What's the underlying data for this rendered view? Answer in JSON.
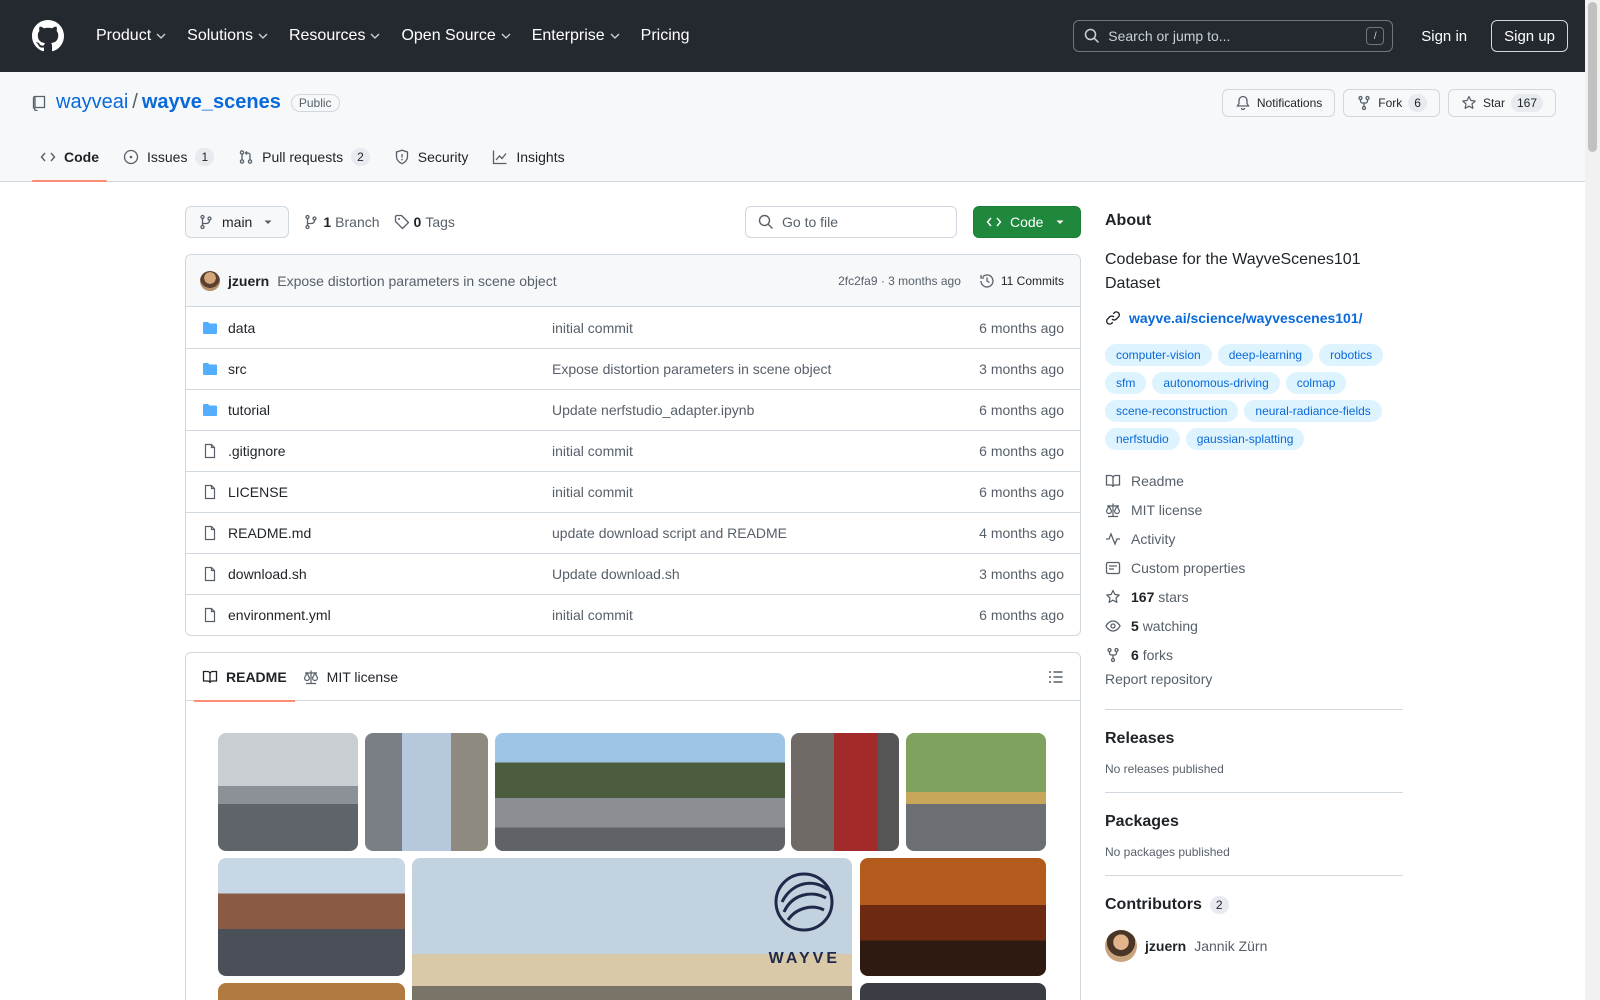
{
  "header": {
    "nav": [
      "Product",
      "Solutions",
      "Resources",
      "Open Source",
      "Enterprise",
      "Pricing"
    ],
    "search_placeholder": "Search or jump to...",
    "slash": "/",
    "signin": "Sign in",
    "signup": "Sign up"
  },
  "repo": {
    "owner": "wayveai",
    "sep": "/",
    "name": "wayve_scenes",
    "visibility": "Public",
    "notifications": "Notifications",
    "fork": "Fork",
    "fork_count": "6",
    "star": "Star",
    "star_count": "167"
  },
  "tabs": {
    "code": "Code",
    "issues": "Issues",
    "issues_count": "1",
    "pulls": "Pull requests",
    "pulls_count": "2",
    "security": "Security",
    "insights": "Insights"
  },
  "toolbar": {
    "branch": "main",
    "branches_count": "1",
    "branches_label": "Branch",
    "tags_count": "0",
    "tags_label": "Tags",
    "goto": "Go to file",
    "code": "Code"
  },
  "commit": {
    "author": "jzuern",
    "message": "Expose distortion parameters in scene object",
    "meta": "2fc2fa9 · 3 months ago",
    "commits": "11 Commits"
  },
  "files": [
    {
      "name": "data",
      "type": "dir",
      "message": "initial commit",
      "age": "6 months ago"
    },
    {
      "name": "src",
      "type": "dir",
      "message": "Expose distortion parameters in scene object",
      "age": "3 months ago"
    },
    {
      "name": "tutorial",
      "type": "dir",
      "message": "Update nerfstudio_adapter.ipynb",
      "age": "6 months ago"
    },
    {
      "name": ".gitignore",
      "type": "file",
      "message": "initial commit",
      "age": "6 months ago"
    },
    {
      "name": "LICENSE",
      "type": "file",
      "message": "initial commit",
      "age": "6 months ago"
    },
    {
      "name": "README.md",
      "type": "file",
      "message": "update download script and README",
      "age": "4 months ago"
    },
    {
      "name": "download.sh",
      "type": "file",
      "message": "Update download.sh",
      "age": "3 months ago"
    },
    {
      "name": "environment.yml",
      "type": "file",
      "message": "initial commit",
      "age": "6 months ago"
    }
  ],
  "readme": {
    "tab_readme": "README",
    "tab_license": "MIT license",
    "logo_text": "WAYVE"
  },
  "about": {
    "title": "About",
    "description": "Codebase for the WayveScenes101 Dataset",
    "link": "wayve.ai/science/wayvescenes101/",
    "topics": [
      "computer-vision",
      "deep-learning",
      "robotics",
      "sfm",
      "autonomous-driving",
      "colmap",
      "scene-reconstruction",
      "neural-radiance-fields",
      "nerfstudio",
      "gaussian-splatting"
    ],
    "readme": "Readme",
    "license": "MIT license",
    "activity": "Activity",
    "custom_props": "Custom properties",
    "stars_count": "167",
    "stars_label": "stars",
    "watching_count": "5",
    "watching_label": "watching",
    "forks_count": "6",
    "forks_label": "forks",
    "report": "Report repository"
  },
  "releases": {
    "title": "Releases",
    "empty": "No releases published"
  },
  "packages": {
    "title": "Packages",
    "empty": "No packages published"
  },
  "contributors": {
    "title": "Contributors",
    "count": "2",
    "user": "jzuern",
    "fullname": "Jannik Zürn"
  },
  "colors": {
    "header_bg": "#24292f",
    "link": "#0969da",
    "green": "#1f883d",
    "tab_underline": "#fd8c73",
    "topic_bg": "#ddf4ff"
  }
}
